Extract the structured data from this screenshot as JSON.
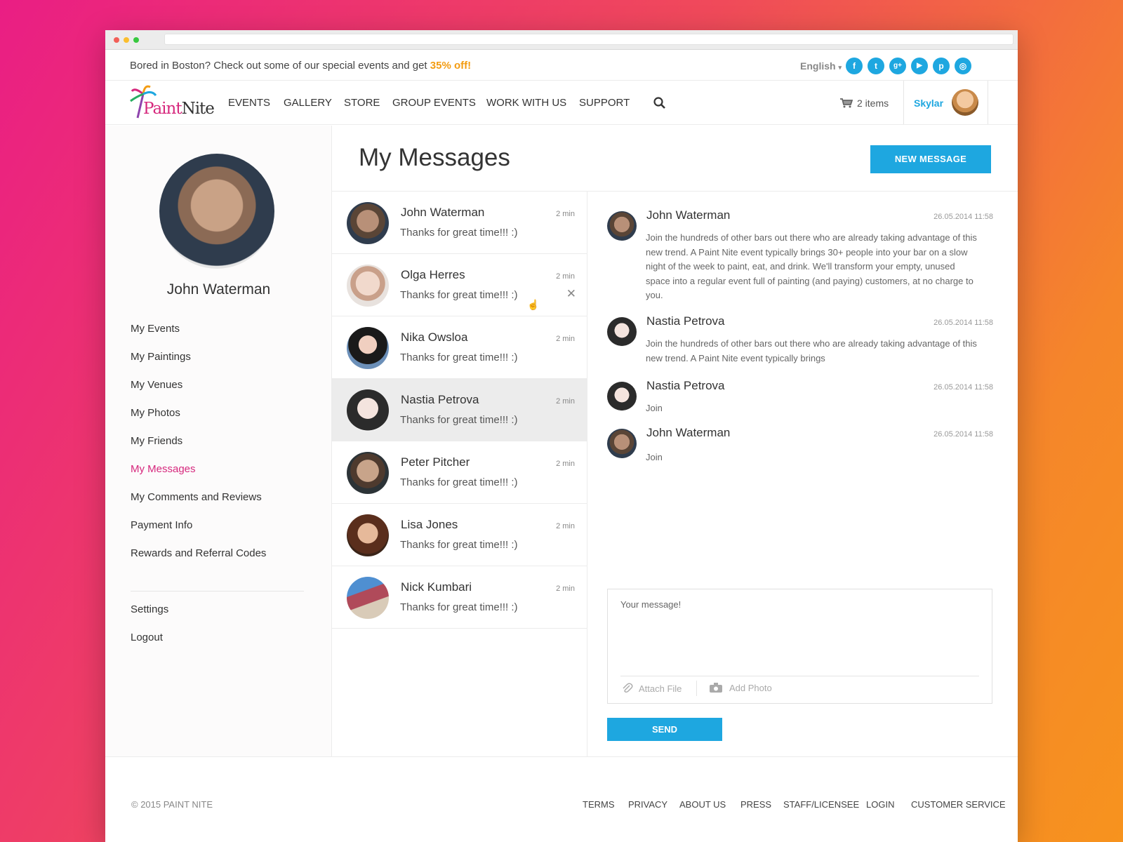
{
  "promo": {
    "text": "Bored in Boston? Check out some of our special events and get ",
    "accent": "35% off!"
  },
  "language": {
    "label": "English",
    "caret": "▾"
  },
  "social": [
    "f",
    "t",
    "g+",
    "▶",
    "p",
    "◎"
  ],
  "brand": {
    "logo_text_paint": "Paint",
    "logo_text_nite": "Nite",
    "primary_color": "#1ea7e0",
    "accent_color": "#d6287d",
    "promo_color": "#f39c12"
  },
  "nav": {
    "items": [
      "EVENTS",
      "GALLERY",
      "STORE",
      "GROUP EVENTS",
      "WORK WITH US",
      "SUPPORT"
    ]
  },
  "cart": {
    "label": "2 items"
  },
  "user": {
    "name": "Skylar"
  },
  "profile": {
    "name": "John Waterman"
  },
  "sidebar": {
    "links": [
      "My Events",
      "My Paintings",
      "My Venues",
      "My Photos",
      "My Friends",
      "My Messages",
      "My Comments and Reviews",
      "Payment Info",
      "Rewards and Referral Codes"
    ],
    "settings": "Settings",
    "logout": "Logout"
  },
  "page": {
    "title": "My Messages",
    "new_message": "NEW MESSAGE"
  },
  "conversations": [
    {
      "name": "John Waterman",
      "time": "2 min",
      "preview": "Thanks for great time!!! :)"
    },
    {
      "name": "Olga Herres",
      "time": "2 min",
      "preview": "Thanks for great time!!! :)",
      "delete": "✕"
    },
    {
      "name": "Nika Owsloa",
      "time": "2 min",
      "preview": "Thanks for great time!!! :)"
    },
    {
      "name": "Nastia Petrova",
      "time": "2 min",
      "preview": "Thanks for great time!!! :)"
    },
    {
      "name": "Peter Pitcher",
      "time": "2 min",
      "preview": "Thanks for great time!!! :)"
    },
    {
      "name": "Lisa Jones",
      "time": "2 min",
      "preview": "Thanks for great time!!! :)"
    },
    {
      "name": "Nick Kumbari",
      "time": "2 min",
      "preview": "Thanks for great time!!! :)"
    }
  ],
  "thread": [
    {
      "name": "John Waterman",
      "time": "26.05.2014 11:58",
      "body": "Join the hundreds of other bars out there who are already taking advantage of this new trend. A Paint Nite event typically brings 30+ people into your bar on a slow night of the week to paint, eat, and drink. We'll transform your empty, unused space into a regular event full of painting (and paying) customers, at no charge to you."
    },
    {
      "name": "Nastia Petrova",
      "time": "26.05.2014 11:58",
      "body": "Join the hundreds of other bars out there who are already taking advantage of this new trend. A Paint Nite event typically brings"
    },
    {
      "name": "Nastia Petrova",
      "time": "26.05.2014 11:58",
      "body": "Join"
    },
    {
      "name": "John Waterman",
      "time": "26.05.2014 11:58",
      "body": "Join"
    }
  ],
  "compose": {
    "placeholder": "Your message!",
    "attach": "Attach File",
    "photo": "Add Photo",
    "send": "SEND"
  },
  "footer": {
    "copyright": "© 2015 PAINT NITE",
    "links": [
      "TERMS",
      "PRIVACY",
      "ABOUT US",
      "PRESS",
      "STAFF/LICENSEE",
      "LOGIN",
      "CUSTOMER SERVICE"
    ]
  }
}
